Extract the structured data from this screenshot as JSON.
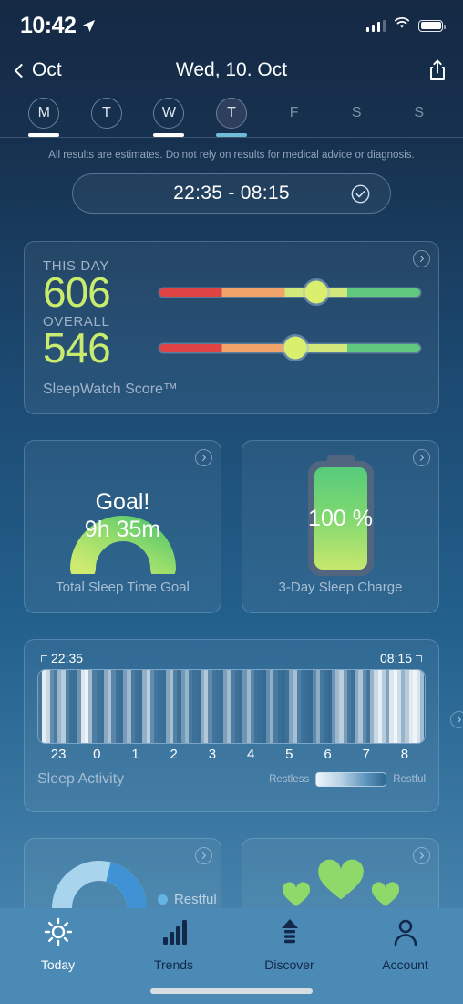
{
  "status_bar": {
    "time": "10:42",
    "location_icon": "location-arrow-icon",
    "signal_icon": "cellular-signal-icon",
    "wifi_icon": "wifi-icon",
    "battery_icon": "battery-icon"
  },
  "nav": {
    "back_label": "Oct",
    "back_icon": "chevron-left-icon",
    "title": "Wed, 10. Oct",
    "share_icon": "share-icon"
  },
  "week": {
    "days": [
      {
        "letter": "M",
        "style": "circled",
        "indicator": "none"
      },
      {
        "letter": "T",
        "style": "circled",
        "indicator": "none"
      },
      {
        "letter": "W",
        "style": "circled",
        "indicator": "selected"
      },
      {
        "letter": "T",
        "style": "filled",
        "indicator": "alt"
      },
      {
        "letter": "F",
        "style": "plain",
        "indicator": "none"
      },
      {
        "letter": "S",
        "style": "plain",
        "indicator": "none"
      },
      {
        "letter": "S",
        "style": "plain",
        "indicator": "none"
      }
    ]
  },
  "disclaimer": "All results are estimates. Do not rely on results for medical advice or diagnosis.",
  "sleep_pill": {
    "range": "22:35 - 08:15",
    "check_icon": "check-circle-icon"
  },
  "score_card": {
    "this_day_label": "THIS DAY",
    "this_day_value": "606",
    "this_day_percent": 60,
    "overall_label": "OVERALL",
    "overall_value": "546",
    "overall_percent": 52,
    "footer": "SleepWatch Score™",
    "arrow_icon": "chevron-right-circle-icon",
    "value_color": "#c9ec6e",
    "slider_colors": [
      "#e04343",
      "#f0a46a",
      "#d2e87a",
      "#5ec97f"
    ]
  },
  "goal_card": {
    "headline": "Goal!",
    "duration": "9h 35m",
    "label": "Total Sleep Time Goal",
    "arrow_icon": "chevron-right-circle-icon",
    "arc_percent": 100,
    "arc_color_from": "#cfeb6f",
    "arc_color_to": "#5ec96c"
  },
  "charge_card": {
    "percent": "100 %",
    "label": "3-Day Sleep Charge",
    "arrow_icon": "chevron-right-circle-icon",
    "fill_percent": 100,
    "battery_icon": "battery-vertical-icon"
  },
  "activity_card": {
    "start_time": "22:35",
    "end_time": "08:15",
    "title": "Sleep Activity",
    "arrow_icon": "chevron-right-circle-icon",
    "hour_labels": [
      "23",
      "0",
      "1",
      "2",
      "3",
      "4",
      "5",
      "6",
      "7",
      "8"
    ],
    "legend_left": "Restless",
    "legend_right": "Restful",
    "chart_data": {
      "type": "heatmap",
      "title": "Sleep Activity",
      "xlabel": "",
      "ylabel": "",
      "x": [
        "23",
        "0",
        "1",
        "2",
        "3",
        "4",
        "5",
        "6",
        "7",
        "8"
      ],
      "legend": [
        "Restless",
        "Restful"
      ],
      "grid": false,
      "note": "Vertical intensity bands across the night: high values = restless (bright), low = restful (dark blue)",
      "values": [
        0.15,
        0.92,
        0.78,
        0.3,
        0.18,
        0.55,
        0.7,
        0.22,
        0.12,
        0.1,
        0.35,
        0.88,
        0.96,
        0.6,
        0.2,
        0.14,
        0.12,
        0.48,
        0.65,
        0.25,
        0.12,
        0.1,
        0.4,
        0.58,
        0.18,
        0.12,
        0.1,
        0.52,
        0.72,
        0.3,
        0.15,
        0.12,
        0.1,
        0.45,
        0.62,
        0.22,
        0.12,
        0.38,
        0.55,
        0.18,
        0.12,
        0.1,
        0.5,
        0.68,
        0.28,
        0.14,
        0.12,
        0.1,
        0.42,
        0.6,
        0.2,
        0.12,
        0.1,
        0.35,
        0.58,
        0.25,
        0.12,
        0.1,
        0.08,
        0.3,
        0.52,
        0.18,
        0.1,
        0.08,
        0.12,
        0.45,
        0.62,
        0.22,
        0.12,
        0.1,
        0.08,
        0.28,
        0.5,
        0.16,
        0.1,
        0.08,
        0.35,
        0.58,
        0.72,
        0.4,
        0.18,
        0.12,
        0.48,
        0.66,
        0.3,
        0.15,
        0.55,
        0.78,
        0.92,
        0.7,
        0.45,
        0.88,
        0.98,
        0.82,
        0.55,
        0.7,
        0.9,
        0.96,
        0.85,
        0.6
      ]
    }
  },
  "partial_cards": {
    "left": {
      "legend_label": "Restful",
      "legend_color": "#64b3e0",
      "arrow_icon": "chevron-right-circle-icon",
      "donut_icon": "donut-chart"
    },
    "right": {
      "arrow_icon": "chevron-right-circle-icon",
      "heart_icon": "heart-icon",
      "heart_color": "#8fd96a"
    }
  },
  "tabbar": {
    "items": [
      {
        "label": "Today",
        "icon": "sun-icon",
        "active": true
      },
      {
        "label": "Trends",
        "icon": "bar-chart-icon",
        "active": false
      },
      {
        "label": "Discover",
        "icon": "upload-arrow-icon",
        "active": false
      },
      {
        "label": "Account",
        "icon": "person-icon",
        "active": false
      }
    ]
  }
}
